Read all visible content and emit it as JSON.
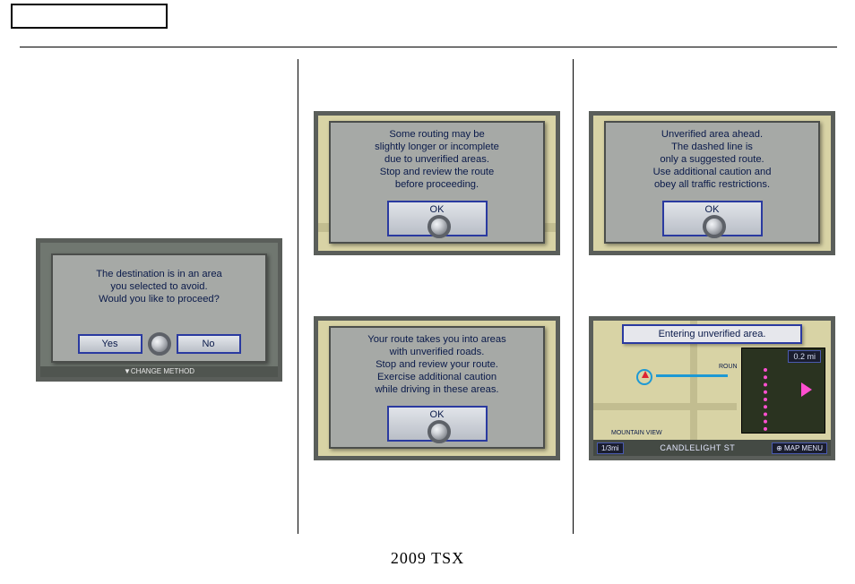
{
  "footer": "2009 TSX",
  "screen1": {
    "text": "The destination is in an area\nyou selected to avoid.\nWould you like to proceed?",
    "yes": "Yes",
    "no": "No",
    "sub": "▼CHANGE METHOD"
  },
  "screen2": {
    "text": "Some routing may be\nslightly longer or incomplete\ndue to unverified areas.\nStop and review the route\nbefore proceeding.",
    "ok": "OK"
  },
  "screen3": {
    "text": "Your route takes you into areas\nwith unverified roads.\nStop and review your route.\nExercise additional caution\nwhile driving in these areas.",
    "ok": "OK"
  },
  "screen4": {
    "text": "Unverified area ahead.\nThe dashed line is\nonly a suggested route.\nUse additional caution and\nobey all traffic restrictions.",
    "ok": "OK"
  },
  "screen5": {
    "banner": "Entering unverified area.",
    "thumb_distance": "0.2 mi",
    "bottom_left": "1/3mi",
    "street": "CANDLELIGHT ST",
    "menu": "⊕ MAP MENU",
    "place": "MOUNTAIN VIEW",
    "road_label": "ROUN"
  }
}
